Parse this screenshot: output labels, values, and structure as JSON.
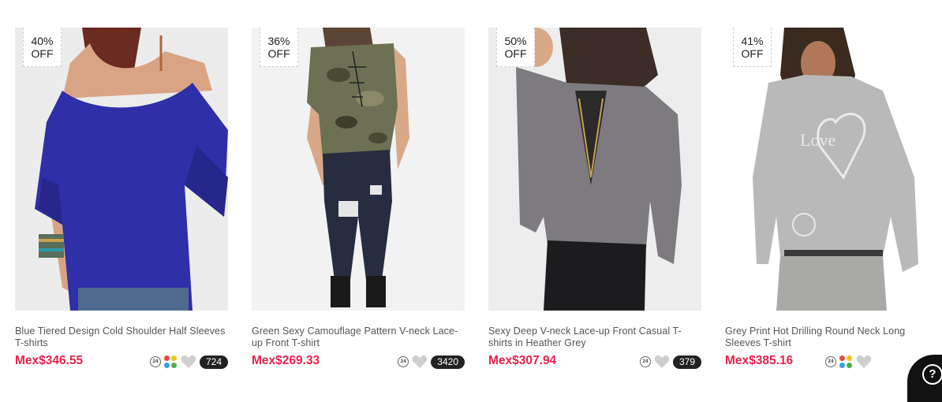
{
  "products": [
    {
      "discount_pct": "40%",
      "discount_label": "OFF",
      "title": "Blue Tiered Design Cold Shoulder Half Sleeves T-shirts",
      "price": "Mex$346.55",
      "ship_icon_text": "24",
      "count": "724",
      "has_colors": true,
      "icons": [
        "24h-shipping-icon",
        "multicolor-icon",
        "heart-icon"
      ]
    },
    {
      "discount_pct": "36%",
      "discount_label": "OFF",
      "title": "Green Sexy Camouflage Pattern V-neck Lace-up Front T-shirt",
      "price": "Mex$269.33",
      "ship_icon_text": "24",
      "count": "3420",
      "has_colors": false,
      "icons": [
        "24h-shipping-icon",
        "heart-icon"
      ]
    },
    {
      "discount_pct": "50%",
      "discount_label": "OFF",
      "title": "Sexy Deep V-neck Lace-up Front Casual T-shirts in Heather Grey",
      "price": "Mex$307.94",
      "ship_icon_text": "24",
      "count": "379",
      "has_colors": false,
      "icons": [
        "24h-shipping-icon",
        "heart-icon"
      ]
    },
    {
      "discount_pct": "41%",
      "discount_label": "OFF",
      "title": "Grey Print Hot Drilling Round Neck Long Sleeves T-shirt",
      "price": "Mex$385.16",
      "ship_icon_text": "24",
      "count": "",
      "has_colors": true,
      "icons": [
        "24h-shipping-icon",
        "multicolor-icon",
        "heart-icon"
      ]
    }
  ],
  "help_button": {
    "label": "?"
  },
  "colors": {
    "price": "#e8224c",
    "count_badge_bg": "#222222",
    "photo_bg": "#eeeeee",
    "swatch": [
      "#e94b3c",
      "#f5c518",
      "#3aa0e8",
      "#4caf50"
    ]
  }
}
